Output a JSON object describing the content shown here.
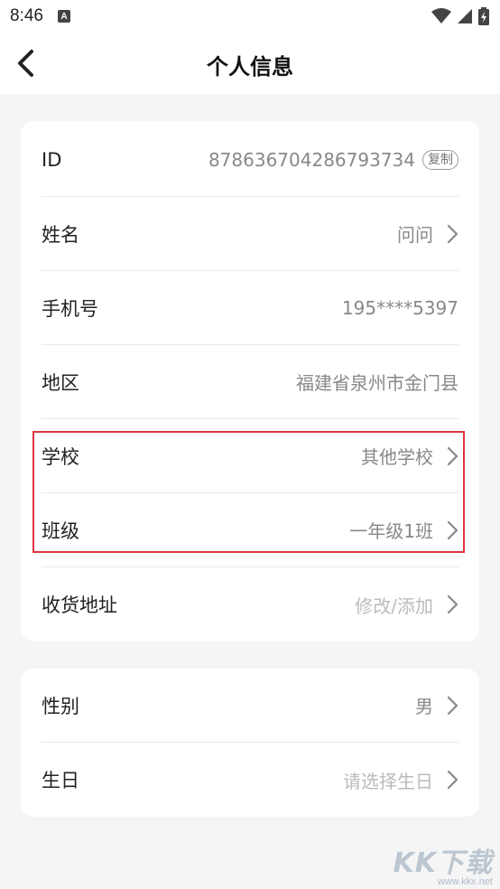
{
  "status_bar": {
    "time": "8:46",
    "notification_icon": "A"
  },
  "header": {
    "back_icon": "chevron-left-icon",
    "title": "个人信息"
  },
  "card1": {
    "rows": [
      {
        "label": "ID",
        "value": "878636704286793734",
        "copy_label": "复制"
      },
      {
        "label": "姓名",
        "value": "问问"
      },
      {
        "label": "手机号",
        "value": "195****5397"
      },
      {
        "label": "地区",
        "value": "福建省泉州市金门县"
      },
      {
        "label": "学校",
        "value": "其他学校"
      },
      {
        "label": "班级",
        "value": "一年级1班"
      },
      {
        "label": "收货地址",
        "value": "修改/添加"
      }
    ]
  },
  "card2": {
    "rows": [
      {
        "label": "性别",
        "value": "男"
      },
      {
        "label": "生日",
        "value": "请选择生日"
      }
    ]
  },
  "colors": {
    "highlight": "#d9363e",
    "background": "#f5f5f5",
    "placeholder": "#bbbbbb"
  },
  "watermark": {
    "logo": "KK下载",
    "url": "www.kkx.net"
  }
}
